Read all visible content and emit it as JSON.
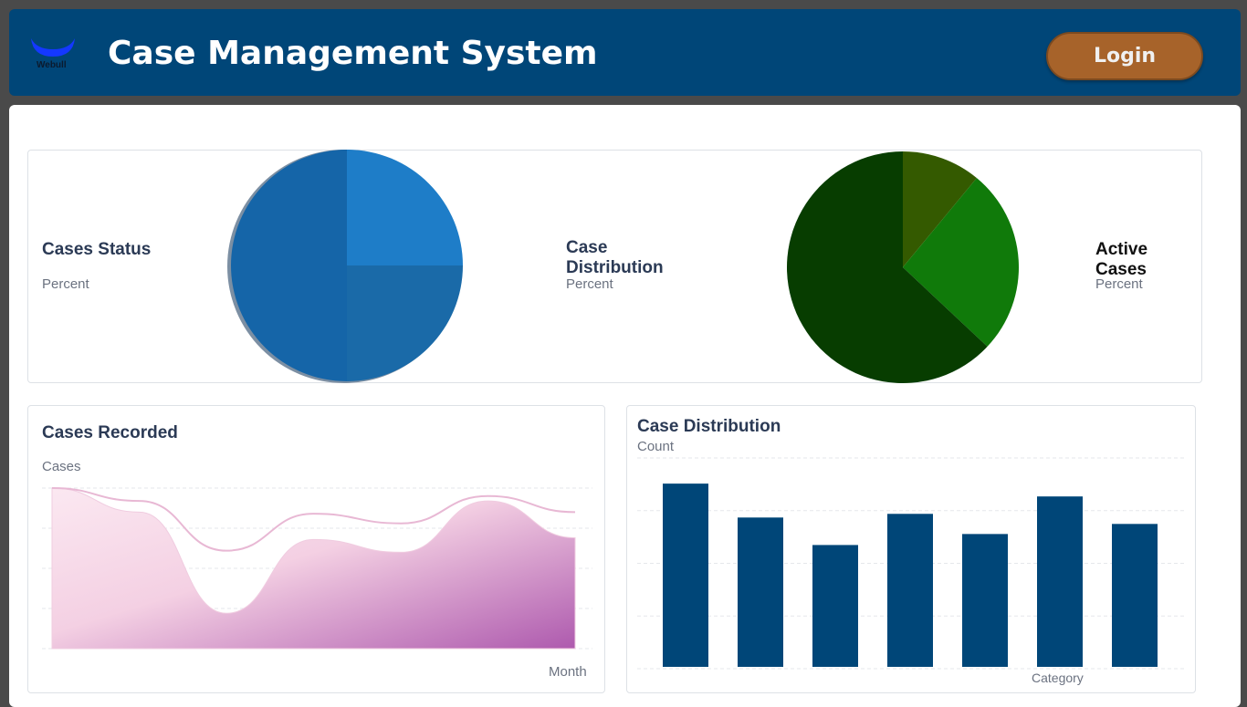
{
  "header": {
    "logo_text": "Webull",
    "title": "Case Management System",
    "login_label": "Login"
  },
  "pies": {
    "left": {
      "title": "Cases Status",
      "subtitle": "Percent"
    },
    "middle": {
      "title_line1": "Case",
      "title_line2": "Distribution",
      "subtitle": "Percent"
    },
    "right": {
      "title": "Active Cases",
      "subtitle": "Percent"
    }
  },
  "cases_recorded": {
    "title": "Cases Recorded",
    "ylabel": "Cases",
    "xlabel": "Month"
  },
  "case_distribution": {
    "title": "Case Distribution",
    "ylabel": "Count",
    "xlabel": "Category"
  },
  "colors": {
    "header_bg": "#004678",
    "login_bg": "#a7632a",
    "bar": "#004678",
    "area": "#b05aa8"
  },
  "chart_data": [
    {
      "type": "pie",
      "name_key": "cases_status",
      "values": [
        25,
        25,
        50
      ],
      "colors": [
        "#1e7dc8",
        "#1a6aa8",
        "#1565a8"
      ]
    },
    {
      "type": "pie",
      "name_key": "active_cases",
      "values": [
        11,
        26,
        63
      ],
      "colors": [
        "#345a00",
        "#107a0a",
        "#073d00"
      ]
    },
    {
      "type": "area",
      "name_key": "cases_recorded",
      "series": [
        {
          "values": [
            100,
            85,
            22,
            68,
            60,
            92,
            69
          ]
        },
        {
          "values": [
            100,
            92,
            61,
            84,
            78,
            95,
            85
          ]
        }
      ]
    },
    {
      "type": "bar",
      "name_key": "case_distribution",
      "values": [
        200,
        163,
        133,
        167,
        145,
        186,
        156
      ],
      "ylim": [
        0,
        230
      ]
    }
  ]
}
